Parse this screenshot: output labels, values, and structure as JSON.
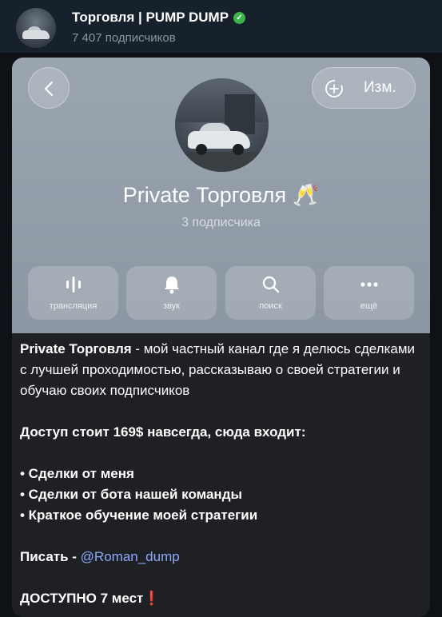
{
  "header": {
    "title": "Торговля | PUMP DUMP",
    "subscribers": "7 407 подписчиков",
    "verified_icon": "verified-icon"
  },
  "profile": {
    "back_icon": "chevron-left-icon",
    "edit_label": "Изм.",
    "edit_icon": "add-circle-icon",
    "name": "Private Торговля 🥂",
    "subscribers": "3 подписчика",
    "actions": [
      {
        "label": "трансляция",
        "icon": "live-stream-icon"
      },
      {
        "label": "звук",
        "icon": "bell-icon"
      },
      {
        "label": "поиск",
        "icon": "search-icon"
      },
      {
        "label": "ещё",
        "icon": "more-dots-icon"
      }
    ]
  },
  "message": {
    "intro_bold": "Private Торговля",
    "intro_rest": " - мой частный канал где я делюсь сделками с лучшей проходимостью, рассказываю о своей стратегии и обучаю своих подписчиков",
    "price_line": "Доступ стоит 169$ навсегда, сюда входит:",
    "bullets": [
      "• Сделки от меня",
      "• Сделки от бота нашей команды",
      "• Краткое обучение моей стратегии"
    ],
    "contact_label": "Писать - ",
    "contact_link": "@Roman_dump",
    "availability": "ДОСТУПНО 7 мест",
    "availability_mark": "❗"
  },
  "colors": {
    "header_bg": "#17212b",
    "profile_bg": "#97a1ac",
    "message_bg": "#1e2024",
    "link": "#8da8ff",
    "accent_red": "#e53935"
  }
}
